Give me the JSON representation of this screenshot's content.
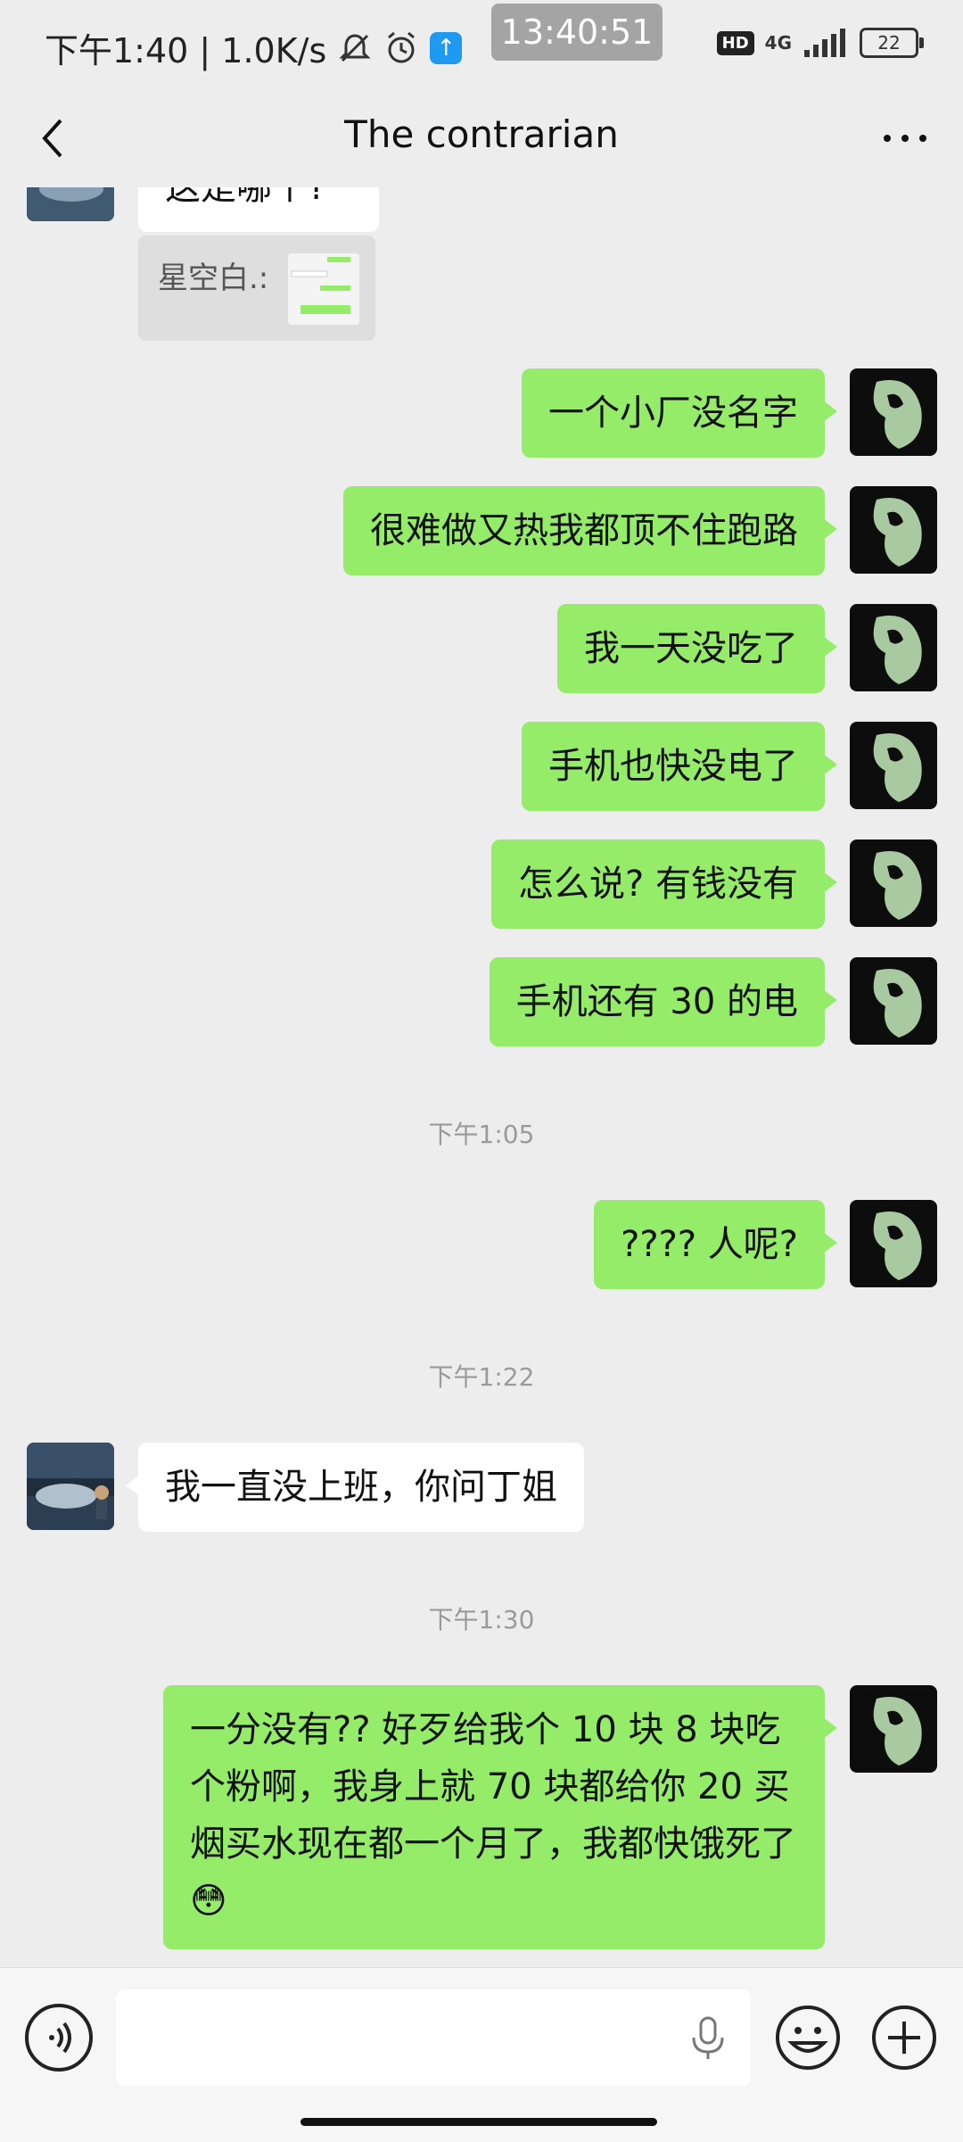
{
  "status_bar": {
    "left_text": "下午1:40 | 1.0K/s",
    "clock": "13:40:51",
    "hd": "HD",
    "network": "4G",
    "battery": "22"
  },
  "nav": {
    "title": "The contrarian"
  },
  "chat": {
    "partial_top_message": "这是哪个?",
    "quote_label": "星空白.:",
    "outgoing": [
      "一个小厂没名字",
      "很难做又热我都顶不住跑路",
      "我一天没吃了",
      "手机也快没电了",
      "怎么说? 有钱没有",
      "手机还有 30 的电"
    ],
    "time_1": "下午1:05",
    "outgoing_2": "???? 人呢?",
    "time_2": "下午1:22",
    "incoming_1": "我一直没上班，你问丁姐",
    "time_3": "下午1:30",
    "outgoing_long": "一分没有?? 好歹给我个 10 块 8 块吃个粉啊，我身上就 70 块都给你 20 买烟买水现在都一个月了，我都快饿死了",
    "outgoing_long_emoji": "😳"
  },
  "input": {
    "placeholder": ""
  },
  "colors": {
    "outgoing_bubble": "#95ec69",
    "incoming_bubble": "#ffffff",
    "background": "#ededed"
  }
}
